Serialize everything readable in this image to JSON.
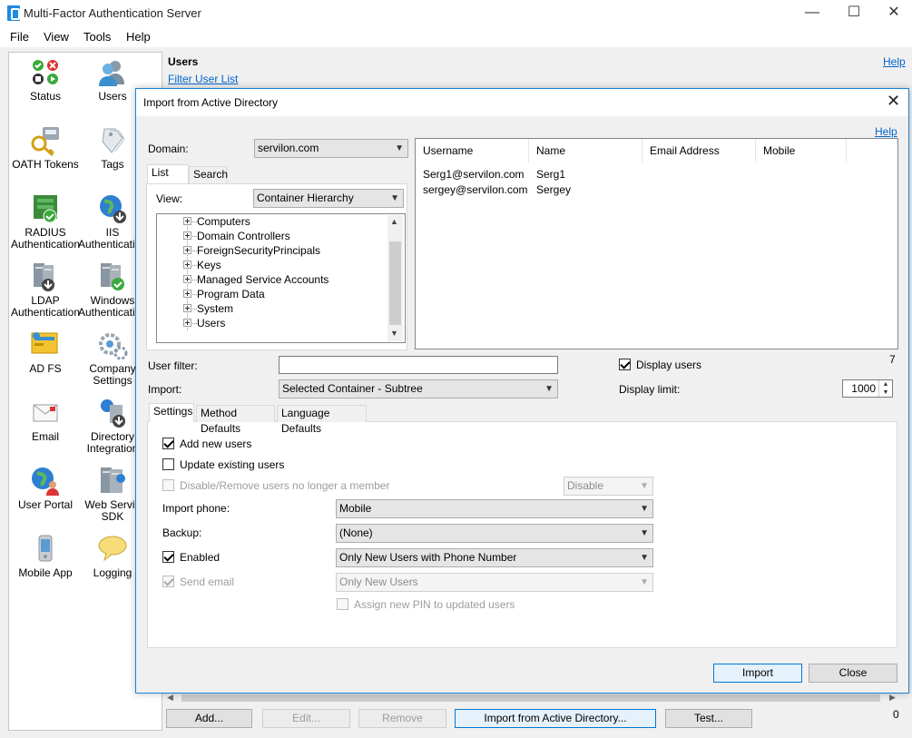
{
  "window": {
    "title": "Multi-Factor Authentication Server",
    "minimize": "—",
    "maximize": "☐",
    "close": "✕"
  },
  "menu": {
    "file": "File",
    "view": "View",
    "tools": "Tools",
    "help": "Help"
  },
  "sidebar": {
    "items": [
      {
        "label": "Status",
        "icon": "status-icon"
      },
      {
        "label": "Users",
        "icon": "users-icon"
      },
      {
        "label": "OATH Tokens",
        "icon": "key-icon"
      },
      {
        "label": "Tags",
        "icon": "tags-icon"
      },
      {
        "label": "RADIUS",
        "label2": "Authentication",
        "icon": "radius-icon"
      },
      {
        "label": "IIS",
        "label2": "Authentication",
        "icon": "globe-icon"
      },
      {
        "label": "LDAP",
        "label2": "Authentication",
        "icon": "ldap-server-icon"
      },
      {
        "label": "Windows",
        "label2": "Authentication",
        "icon": "windows-server-icon"
      },
      {
        "label": "AD FS",
        "icon": "adfs-icon"
      },
      {
        "label": "Company",
        "label2": "Settings",
        "icon": "gears-icon"
      },
      {
        "label": "Email",
        "icon": "email-icon"
      },
      {
        "label": "Directory",
        "label2": "Integration",
        "icon": "directory-icon"
      },
      {
        "label": "User Portal",
        "icon": "user-portal-icon"
      },
      {
        "label": "Web Servic",
        "label2": "SDK",
        "icon": "web-service-icon"
      },
      {
        "label": "Mobile App",
        "icon": "mobile-icon"
      },
      {
        "label": "Logging",
        "icon": "speech-bubble-icon"
      }
    ]
  },
  "main": {
    "header": "Users",
    "help": "Help",
    "filter_link": "Filter User List",
    "count": "0",
    "buttons": {
      "add": "Add...",
      "edit": "Edit...",
      "remove": "Remove",
      "import_ad": "Import from Active Directory...",
      "test": "Test..."
    }
  },
  "dialog": {
    "title": "Import from Active Directory",
    "close": "✕",
    "help": "Help",
    "domain_label": "Domain:",
    "domain_value": "servilon.com",
    "tabs_left": [
      "List",
      "Search"
    ],
    "view_label": "View:",
    "view_value": "Container Hierarchy",
    "tree": [
      "Computers",
      "Domain Controllers",
      "ForeignSecurityPrincipals",
      "Keys",
      "Managed Service Accounts",
      "Program Data",
      "System",
      "Users"
    ],
    "grid": {
      "columns": [
        "Username",
        "Name",
        "Email Address",
        "Mobile"
      ],
      "rows": [
        {
          "username": "Serg1@servilon.com",
          "name": "Serg1"
        },
        {
          "username": "sergey@servilon.com",
          "name": "Sergey"
        }
      ],
      "count": "7"
    },
    "user_filter_label": "User filter:",
    "user_filter_value": "",
    "display_users_label": "Display users",
    "import_label": "Import:",
    "import_value": "Selected Container - Subtree",
    "display_limit_label": "Display limit:",
    "display_limit_value": "1000",
    "tabs_settings": [
      "Settings",
      "Method Defaults",
      "Language Defaults"
    ],
    "settings": {
      "add_new_users": "Add new users",
      "update_existing_users": "Update existing users",
      "disable_remove_users": "Disable/Remove users no longer a member",
      "disable_select": "Disable",
      "import_phone_label": "Import phone:",
      "import_phone_value": "Mobile",
      "backup_label": "Backup:",
      "backup_value": "(None)",
      "enabled_label": "Enabled",
      "enabled_value": "Only New Users with Phone Number",
      "send_email_label": "Send email",
      "send_email_value": "Only New Users",
      "assign_pin_label": "Assign new PIN to updated users"
    },
    "buttons": {
      "import": "Import",
      "close": "Close"
    }
  },
  "colors": {
    "accent": "#0078d7",
    "link": "#0066cc",
    "dialog_border": "#1883d7"
  }
}
